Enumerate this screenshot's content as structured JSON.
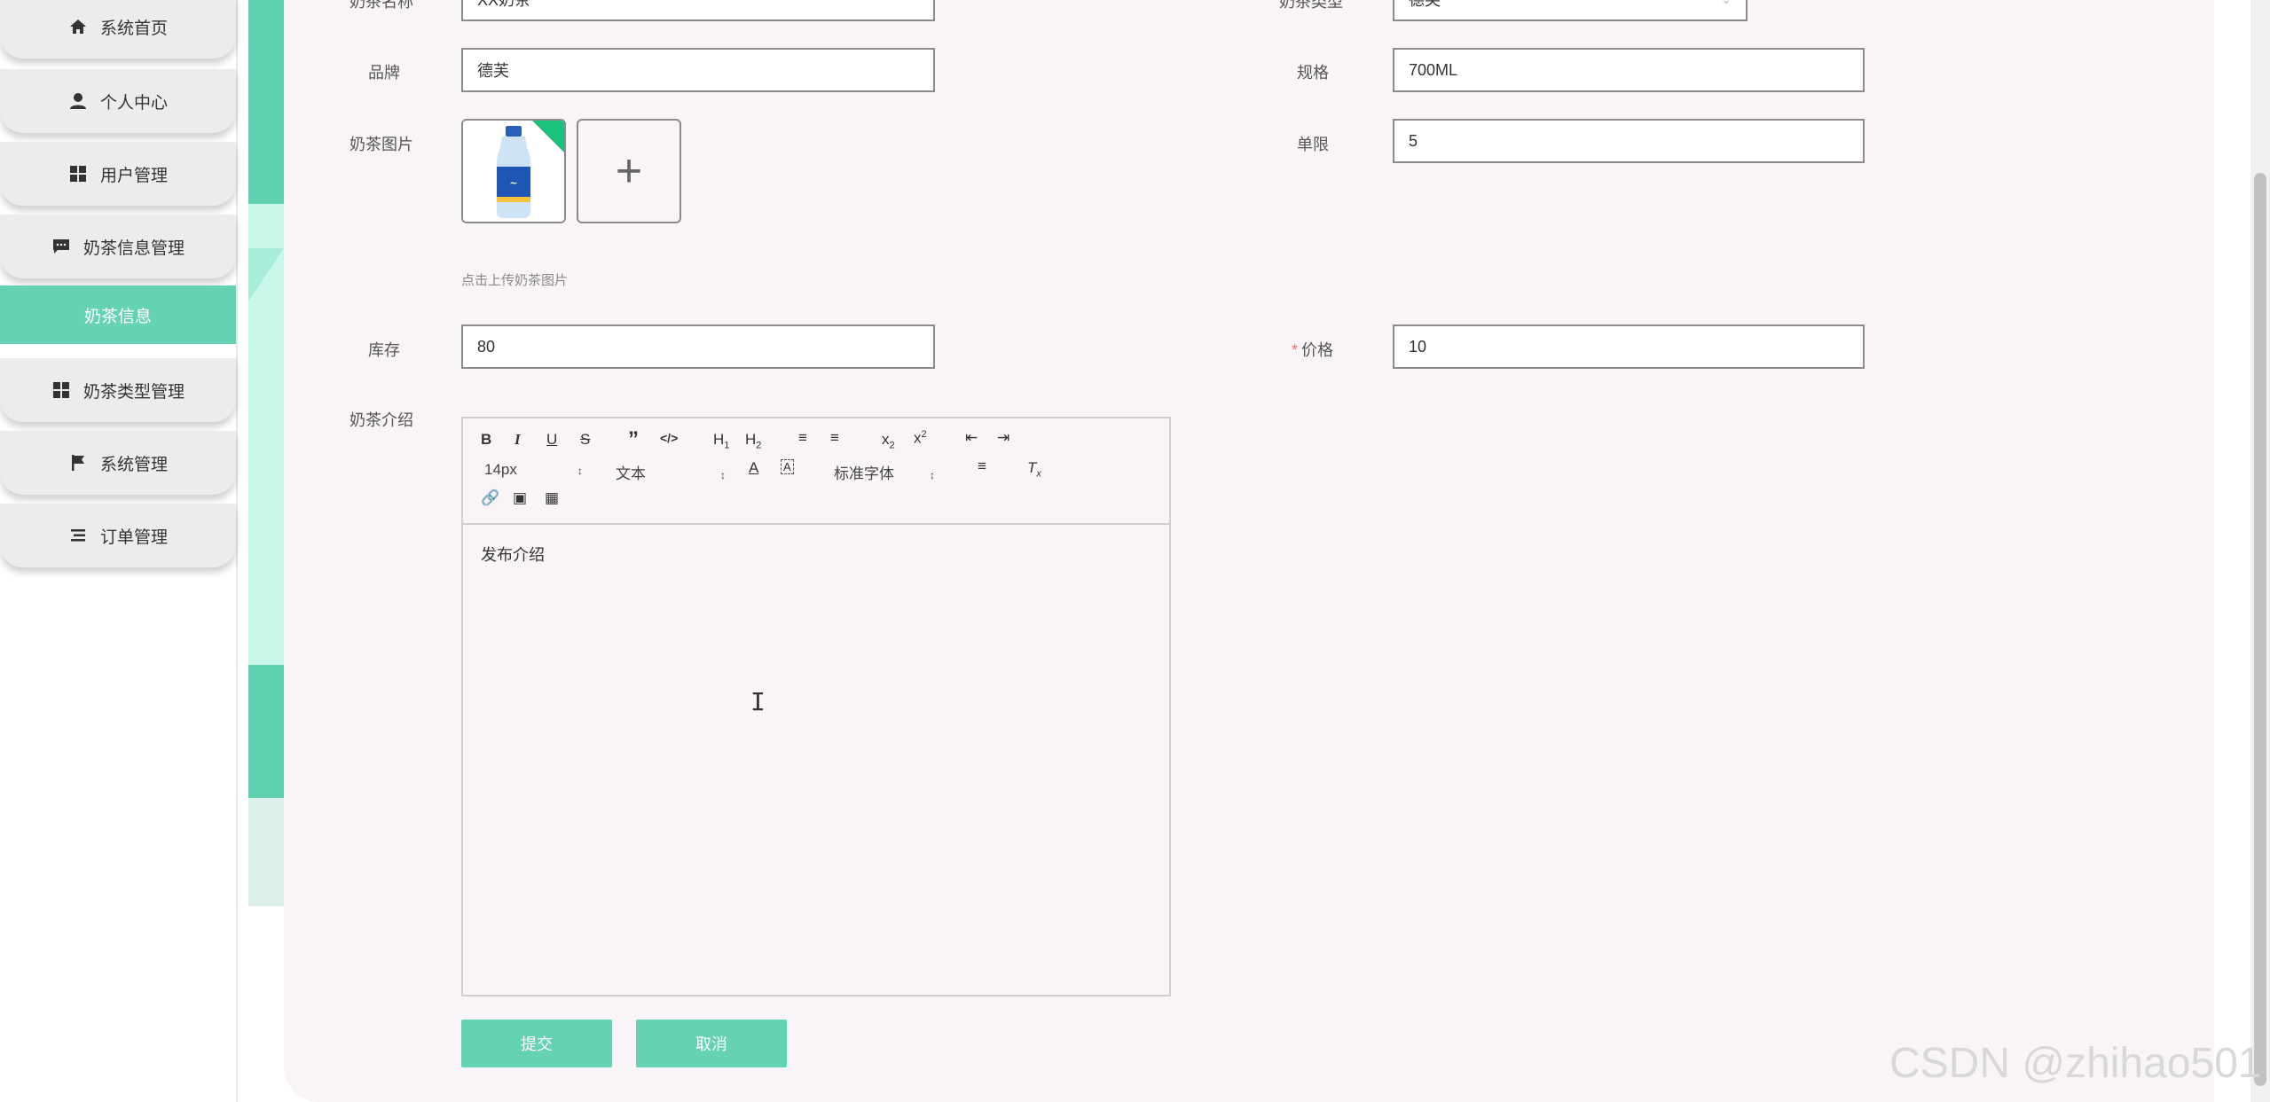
{
  "sidebar": {
    "items": [
      {
        "label": "系统首页",
        "icon": "home-icon"
      },
      {
        "label": "个人中心",
        "icon": "user-icon"
      },
      {
        "label": "用户管理",
        "icon": "grid-icon"
      },
      {
        "label": "奶茶信息管理",
        "icon": "chat-icon"
      },
      {
        "label": "奶茶信息",
        "icon": ""
      },
      {
        "label": "奶茶类型管理",
        "icon": "grid-icon"
      },
      {
        "label": "系统管理",
        "icon": "flag-icon"
      },
      {
        "label": "订单管理",
        "icon": "list-icon"
      }
    ],
    "active_color": "#66d2b4"
  },
  "form": {
    "name_label": "奶茶名称",
    "name_value": "XX奶茶",
    "type_label": "奶茶类型",
    "type_value": "德芙",
    "brand_label": "品牌",
    "brand_value": "德芙",
    "spec_label": "规格",
    "spec_value": "700ML",
    "image_label": "奶茶图片",
    "image_hint": "点击上传奶茶图片",
    "limit_label": "单限",
    "limit_value": "5",
    "stock_label": "库存",
    "stock_value": "80",
    "price_required": "*",
    "price_label": "价格",
    "price_value": "10",
    "intro_label": "奶茶介绍"
  },
  "editor": {
    "size_select": "14px",
    "text_select": "文本",
    "font_select": "标准字体",
    "content": "发布介绍"
  },
  "buttons": {
    "submit": "提交",
    "cancel": "取消"
  },
  "watermark": "CSDN @zhihao501",
  "colors": {
    "accent": "#66d2b4",
    "card_bg": "#f8f4f8"
  }
}
